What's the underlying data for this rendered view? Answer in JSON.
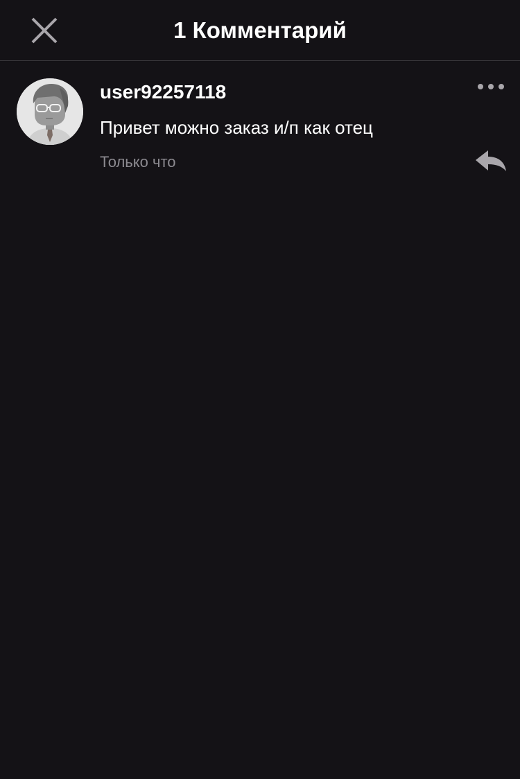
{
  "header": {
    "title": "1 Комментарий",
    "close_icon": "close-icon"
  },
  "comments": [
    {
      "username": "user92257118",
      "text": "Привет можно заказ и/п как отец",
      "time": "Только что",
      "avatar_icon": "default-avatar",
      "more_icon": "more-dots-icon",
      "reply_icon": "reply-icon"
    }
  ],
  "colors": {
    "background": "#141216",
    "divider": "#3a383c",
    "secondary_text": "#8c8a90",
    "icon_gray": "#a9a6ab"
  }
}
